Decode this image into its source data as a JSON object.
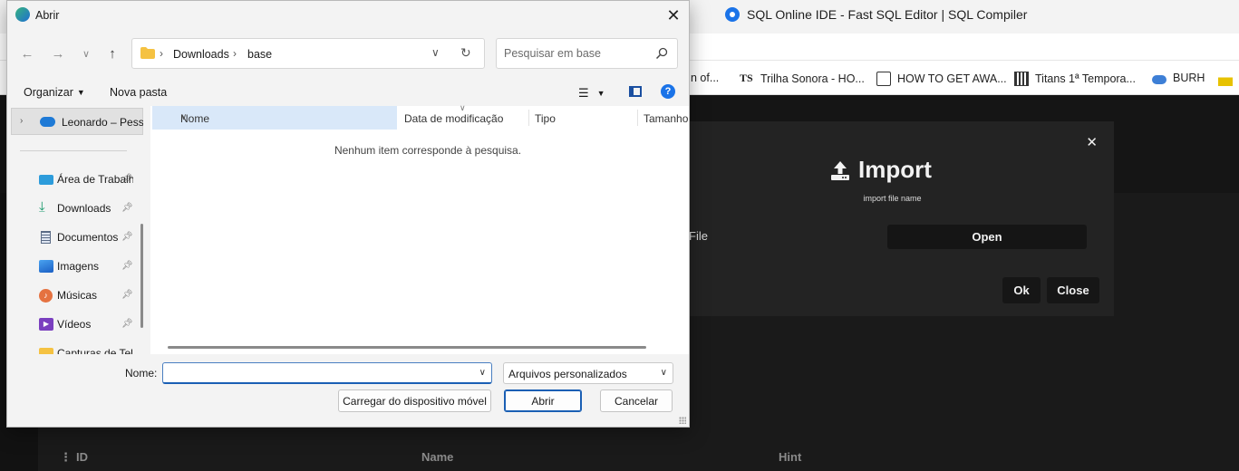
{
  "browser": {
    "tab_title": "SQL Online IDE - Fast SQL Editor | SQL Compiler",
    "bookmarks": [
      {
        "label": "n of...",
        "icon": "page-icon"
      },
      {
        "label": "Trilha Sonora - HO...",
        "icon": "ts-logo-icon"
      },
      {
        "label": "HOW TO GET AWA...",
        "icon": "page-icon"
      },
      {
        "label": "Titans 1ª Tempora...",
        "icon": "film-icon"
      },
      {
        "label": "BURH",
        "icon": "cloud-icon"
      }
    ]
  },
  "import_modal": {
    "title": "Import",
    "subtitle": "import file name",
    "file_label": "File",
    "open_button": "Open",
    "ok_button": "Ok",
    "close_button": "Close",
    "close_x": "✕"
  },
  "grid": {
    "columns": [
      "ID",
      "Name",
      "Hint"
    ],
    "handle": "⋮"
  },
  "dialog": {
    "title": "Abrir",
    "breadcrumb": [
      "Downloads",
      "base"
    ],
    "search_placeholder": "Pesquisar em base",
    "toolbar": {
      "organize": "Organizar",
      "new_folder": "Nova pasta"
    },
    "nav": {
      "onedrive": "Leonardo – Pessoal",
      "items": [
        {
          "label": "Área de Trabalho",
          "icon": "desktop-icon"
        },
        {
          "label": "Downloads",
          "icon": "download-icon"
        },
        {
          "label": "Documentos",
          "icon": "document-icon"
        },
        {
          "label": "Imagens",
          "icon": "image-icon"
        },
        {
          "label": "Músicas",
          "icon": "music-icon"
        },
        {
          "label": "Vídeos",
          "icon": "video-icon"
        },
        {
          "label": "Capturas de Tela",
          "icon": "folder-icon"
        }
      ]
    },
    "columns": {
      "name": "Nome",
      "modified": "Data de modificação",
      "type": "Tipo",
      "size": "Tamanho"
    },
    "empty_message": "Nenhum item corresponde à pesquisa.",
    "filename_label": "Nome:",
    "filename_value": "",
    "file_type": "Arquivos personalizados",
    "buttons": {
      "upload": "Carregar do dispositivo móvel",
      "open": "Abrir",
      "cancel": "Cancelar"
    }
  }
}
